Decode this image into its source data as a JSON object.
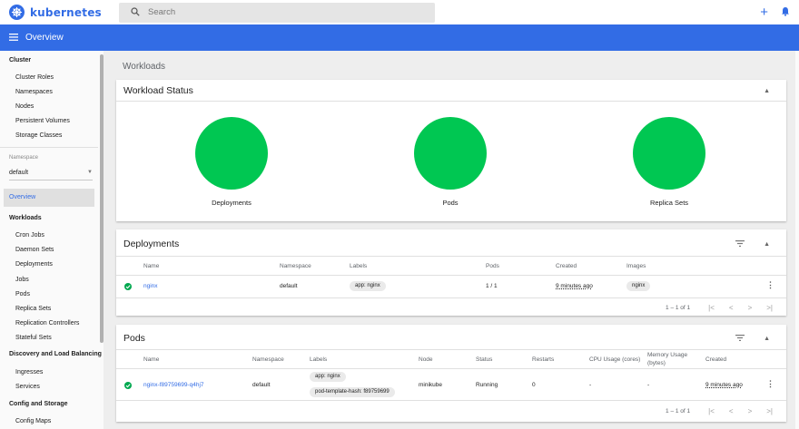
{
  "app": {
    "brand": "kubernetes",
    "search_placeholder": "Search"
  },
  "header": {
    "title": "Overview"
  },
  "sidebar": {
    "cluster_heading": "Cluster",
    "cluster_items": [
      "Cluster Roles",
      "Namespaces",
      "Nodes",
      "Persistent Volumes",
      "Storage Classes"
    ],
    "namespace_label": "Namespace",
    "namespace_value": "default",
    "overview": "Overview",
    "workloads_heading": "Workloads",
    "workload_items": [
      "Cron Jobs",
      "Daemon Sets",
      "Deployments",
      "Jobs",
      "Pods",
      "Replica Sets",
      "Replication Controllers",
      "Stateful Sets"
    ],
    "discovery_heading": "Discovery and Load Balancing",
    "discovery_items": [
      "Ingresses",
      "Services"
    ],
    "config_heading": "Config and Storage",
    "config_items": [
      "Config Maps"
    ]
  },
  "main": {
    "page_title": "Workloads",
    "workload_status": {
      "title": "Workload Status",
      "items": [
        {
          "label": "Deployments"
        },
        {
          "label": "Pods"
        },
        {
          "label": "Replica Sets"
        }
      ]
    },
    "deployments": {
      "title": "Deployments",
      "columns": [
        "Name",
        "Namespace",
        "Labels",
        "Pods",
        "Created",
        "Images"
      ],
      "rows": [
        {
          "name": "nginx",
          "namespace": "default",
          "labels": "app: nginx",
          "pods": "1 / 1",
          "created": "9 minutes ago",
          "images": "nginx"
        }
      ],
      "range": "1 – 1 of 1"
    },
    "pods": {
      "title": "Pods",
      "columns": [
        "Name",
        "Namespace",
        "Labels",
        "Node",
        "Status",
        "Restarts",
        "CPU Usage (cores)",
        "Memory Usage",
        "(bytes)",
        "Created"
      ],
      "rows": [
        {
          "name": "nginx-f89759699-q4hj7",
          "namespace": "default",
          "label1": "app: nginx",
          "label2": "pod-template-hash: f89759699",
          "node": "minikube",
          "status": "Running",
          "restarts": "0",
          "cpu": "-",
          "memory": "-",
          "created": "9 minutes ago"
        }
      ],
      "range": "1 – 1 of 1"
    }
  },
  "pager_icons": {
    "first": "|<",
    "prev": "<",
    "next": ">",
    "last": ">|"
  },
  "colors": {
    "brand": "#326ce5",
    "success": "#00c752"
  }
}
